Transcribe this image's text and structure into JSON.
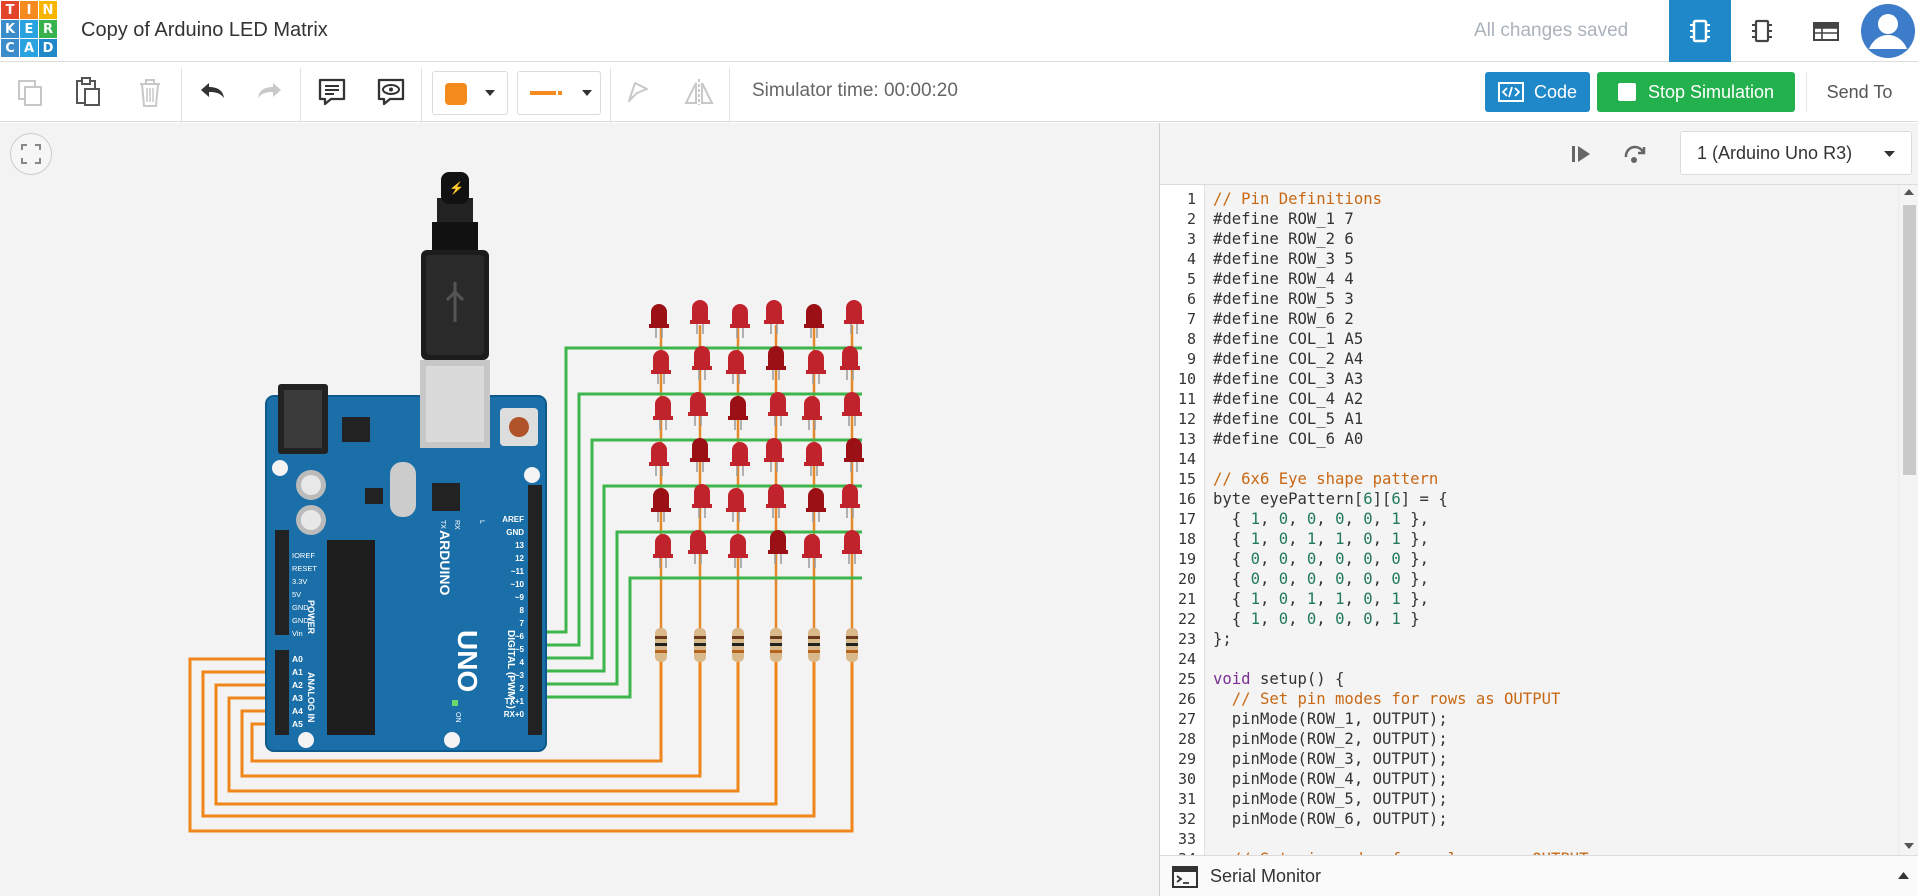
{
  "app": {
    "logo_letters": [
      "T",
      "I",
      "N",
      "K",
      "E",
      "R",
      "C",
      "A",
      "D"
    ],
    "logo_colors": [
      "#e2452a",
      "#f58b1f",
      "#f7b500",
      "#3a8ccb",
      "#29a3df",
      "#37b24d",
      "#3a8ccb",
      "#29a3df",
      "#1e88c9"
    ],
    "title": "Copy of Arduino LED Matrix",
    "save_status": "All changes saved",
    "view_icons": [
      "circuit-view-icon",
      "schematic-view-icon",
      "component-list-icon"
    ],
    "accent": "#1e88c9"
  },
  "toolbar": {
    "icons": [
      "copy-icon",
      "paste-icon",
      "delete-icon",
      "undo-icon",
      "redo-icon",
      "notes-icon",
      "visibility-icon",
      "color-swatch",
      "line-style",
      "rotate-icon",
      "flip-icon"
    ],
    "color_value": "#f58a1f",
    "simulator_time": "Simulator time: 00:00:20",
    "code_label": "Code",
    "stop_label": "Stop Simulation",
    "send_label": "Send To",
    "stop_color": "#22b14c"
  },
  "editor": {
    "device": "1 (Arduino Uno R3)",
    "serial_label": "Serial Monitor",
    "first_line_no": 1,
    "lines": [
      [
        [
          "// Pin Definitions",
          "cm"
        ]
      ],
      [
        [
          "#define ROW_1 7",
          ""
        ]
      ],
      [
        [
          "#define ROW_2 6",
          ""
        ]
      ],
      [
        [
          "#define ROW_3 5",
          ""
        ]
      ],
      [
        [
          "#define ROW_4 4",
          ""
        ]
      ],
      [
        [
          "#define ROW_5 3",
          ""
        ]
      ],
      [
        [
          "#define ROW_6 2",
          ""
        ]
      ],
      [
        [
          "#define COL_1 A5",
          ""
        ]
      ],
      [
        [
          "#define COL_2 A4",
          ""
        ]
      ],
      [
        [
          "#define COL_3 A3",
          ""
        ]
      ],
      [
        [
          "#define COL_4 A2",
          ""
        ]
      ],
      [
        [
          "#define COL_5 A1",
          ""
        ]
      ],
      [
        [
          "#define COL_6 A0",
          ""
        ]
      ],
      [
        [
          "",
          ""
        ]
      ],
      [
        [
          "// 6x6 Eye shape pattern",
          "cm"
        ]
      ],
      [
        [
          "byte eyePattern[",
          ""
        ],
        [
          "6",
          "nm"
        ],
        [
          "][",
          ""
        ],
        [
          "6",
          "nm"
        ],
        [
          "] = {",
          ""
        ]
      ],
      [
        [
          "  { ",
          ""
        ],
        [
          "1",
          "nm"
        ],
        [
          ", ",
          ""
        ],
        [
          "0",
          "nm"
        ],
        [
          ", ",
          ""
        ],
        [
          "0",
          "nm"
        ],
        [
          ", ",
          ""
        ],
        [
          "0",
          "nm"
        ],
        [
          ", ",
          ""
        ],
        [
          "0",
          "nm"
        ],
        [
          ", ",
          ""
        ],
        [
          "1",
          "nm"
        ],
        [
          " },",
          ""
        ]
      ],
      [
        [
          "  { ",
          ""
        ],
        [
          "1",
          "nm"
        ],
        [
          ", ",
          ""
        ],
        [
          "0",
          "nm"
        ],
        [
          ", ",
          ""
        ],
        [
          "1",
          "nm"
        ],
        [
          ", ",
          ""
        ],
        [
          "1",
          "nm"
        ],
        [
          ", ",
          ""
        ],
        [
          "0",
          "nm"
        ],
        [
          ", ",
          ""
        ],
        [
          "1",
          "nm"
        ],
        [
          " },",
          ""
        ]
      ],
      [
        [
          "  { ",
          ""
        ],
        [
          "0",
          "nm"
        ],
        [
          ", ",
          ""
        ],
        [
          "0",
          "nm"
        ],
        [
          ", ",
          ""
        ],
        [
          "0",
          "nm"
        ],
        [
          ", ",
          ""
        ],
        [
          "0",
          "nm"
        ],
        [
          ", ",
          ""
        ],
        [
          "0",
          "nm"
        ],
        [
          ", ",
          ""
        ],
        [
          "0",
          "nm"
        ],
        [
          " },",
          ""
        ]
      ],
      [
        [
          "  { ",
          ""
        ],
        [
          "0",
          "nm"
        ],
        [
          ", ",
          ""
        ],
        [
          "0",
          "nm"
        ],
        [
          ", ",
          ""
        ],
        [
          "0",
          "nm"
        ],
        [
          ", ",
          ""
        ],
        [
          "0",
          "nm"
        ],
        [
          ", ",
          ""
        ],
        [
          "0",
          "nm"
        ],
        [
          ", ",
          ""
        ],
        [
          "0",
          "nm"
        ],
        [
          " },",
          ""
        ]
      ],
      [
        [
          "  { ",
          ""
        ],
        [
          "1",
          "nm"
        ],
        [
          ", ",
          ""
        ],
        [
          "0",
          "nm"
        ],
        [
          ", ",
          ""
        ],
        [
          "1",
          "nm"
        ],
        [
          ", ",
          ""
        ],
        [
          "1",
          "nm"
        ],
        [
          ", ",
          ""
        ],
        [
          "0",
          "nm"
        ],
        [
          ", ",
          ""
        ],
        [
          "1",
          "nm"
        ],
        [
          " },",
          ""
        ]
      ],
      [
        [
          "  { ",
          ""
        ],
        [
          "1",
          "nm"
        ],
        [
          ", ",
          ""
        ],
        [
          "0",
          "nm"
        ],
        [
          ", ",
          ""
        ],
        [
          "0",
          "nm"
        ],
        [
          ", ",
          ""
        ],
        [
          "0",
          "nm"
        ],
        [
          ", ",
          ""
        ],
        [
          "0",
          "nm"
        ],
        [
          ", ",
          ""
        ],
        [
          "1",
          "nm"
        ],
        [
          " }",
          ""
        ]
      ],
      [
        [
          "};",
          ""
        ]
      ],
      [
        [
          "",
          ""
        ]
      ],
      [
        [
          "void",
          "kw"
        ],
        [
          " setup() {",
          ""
        ]
      ],
      [
        [
          "  // Set pin modes for rows as OUTPUT",
          "cm"
        ]
      ],
      [
        [
          "  pinMode(ROW_1, OUTPUT);",
          ""
        ]
      ],
      [
        [
          "  pinMode(ROW_2, OUTPUT);",
          ""
        ]
      ],
      [
        [
          "  pinMode(ROW_3, OUTPUT);",
          ""
        ]
      ],
      [
        [
          "  pinMode(ROW_4, OUTPUT);",
          ""
        ]
      ],
      [
        [
          "  pinMode(ROW_5, OUTPUT);",
          ""
        ]
      ],
      [
        [
          "  pinMode(ROW_6, OUTPUT);",
          ""
        ]
      ],
      [
        [
          "",
          ""
        ]
      ],
      [
        [
          "  // Set pin modes for columns as OUTPUT",
          "cm"
        ]
      ]
    ]
  },
  "board": {
    "brand": "ARDUINO",
    "model": "UNO",
    "digital_label": "DIGITAL (PWM~)",
    "power_label": "POWER",
    "analog_label": "ANALOG IN",
    "on_label": "ON",
    "left_pins": [
      "IOREF",
      "RESET",
      "3.3V",
      "5V",
      "GND",
      "GND",
      "Vin"
    ],
    "analog_pins": [
      "A0",
      "A1",
      "A2",
      "A3",
      "A4",
      "A5"
    ],
    "digital_pins": [
      "AREF",
      "GND",
      "13",
      "12",
      "~11",
      "~10",
      "~9",
      "8",
      "7",
      "~6",
      "~5",
      "4",
      "~3",
      "2",
      "TX+1",
      "RX+0"
    ],
    "tx_label": "TX",
    "rx_label": "RX",
    "l_label": "L",
    "usb_label": "⚡"
  },
  "matrix": {
    "rows": 6,
    "cols": 6,
    "led_color": "#c0232b",
    "lit_color": "#9a1015"
  }
}
